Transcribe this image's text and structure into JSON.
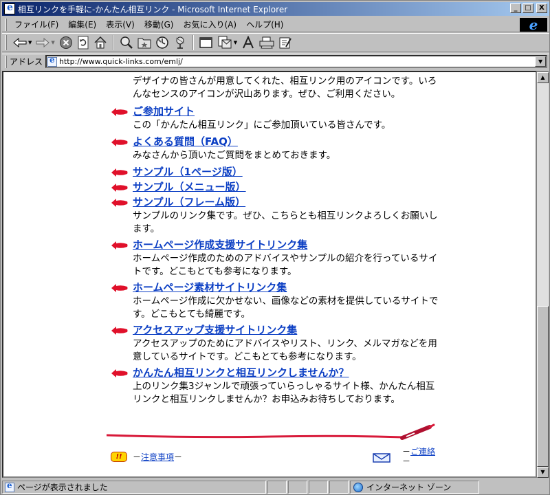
{
  "window": {
    "title": "相互リンクを手軽に-かんたん相互リンク - Microsoft Internet Explorer",
    "buttons": {
      "minimize": "_",
      "maximize": "□",
      "close": "X"
    }
  },
  "menu": {
    "items": [
      "ファイル(F)",
      "編集(E)",
      "表示(V)",
      "移動(G)",
      "お気に入り(A)",
      "ヘルプ(H)"
    ],
    "logo": "e"
  },
  "toolbar": {
    "buttons": [
      "back",
      "forward",
      "stop",
      "refresh",
      "home",
      "search",
      "favorites",
      "history",
      "channels",
      "fullscreen",
      "mail",
      "font",
      "print",
      "edit"
    ]
  },
  "address": {
    "label": "アドレス",
    "url": "http://www.quick-links.com/emlj/"
  },
  "content": {
    "top_description": "デザイナの皆さんが用意してくれた、相互リンク用のアイコンです。いろんなセンスのアイコンが沢山あります。ぜひ、ご利用ください。",
    "entries": [
      {
        "title": "ご参加サイト",
        "description": "この「かんたん相互リンク」にご参加頂いている皆さんです。"
      },
      {
        "title": "よくある質問（FAQ）",
        "description": "みなさんから頂いたご質問をまとめておきます。"
      },
      {
        "title": "サンプル（1ページ版）",
        "description": ""
      },
      {
        "title": "サンプル（メニュー版）",
        "description": ""
      },
      {
        "title": "サンプル（フレーム版）",
        "description": "サンプルのリンク集です。ぜひ、こちらとも相互リンクよろしくお願いします。"
      },
      {
        "title": "ホームページ作成支援サイトリンク集",
        "description": "ホームページ作成のためのアドバイスやサンプルの紹介を行っているサイトです。どこもとても参考になります。"
      },
      {
        "title": "ホームページ素材サイトリンク集",
        "description": "ホームページ作成に欠かせない、画像などの素材を提供しているサイトです。どこもとても綺麗です。"
      },
      {
        "title": "アクセスアップ支援サイトリンク集",
        "description": "アクセスアップのためにアドバイスやリスト、リンク、メルマガなどを用意しているサイトです。どこもとても参考になります。"
      },
      {
        "title": "かんたん相互リンクと相互リンクしませんか？",
        "description": "上のリンク集3ジャンルで頑張っていらっしゃるサイト様、かんたん相互リンクと相互リンクしませんか？お申込みお待ちしております。"
      }
    ],
    "footer": {
      "caution_badge": "!!",
      "caution_prefix": "－",
      "caution_link": "注意事項",
      "caution_suffix": "－",
      "contact_prefix": "－",
      "contact_link": "ご連絡",
      "contact_suffix": "－"
    }
  },
  "status": {
    "text": "ページが表示されました",
    "zone": "インターネット ゾーン"
  },
  "colors": {
    "link": "#0c3fc4",
    "arrow": "#e0102a",
    "divider": "#d81a3a",
    "titlebar_start": "#0a246a",
    "titlebar_end": "#a6caf0"
  }
}
